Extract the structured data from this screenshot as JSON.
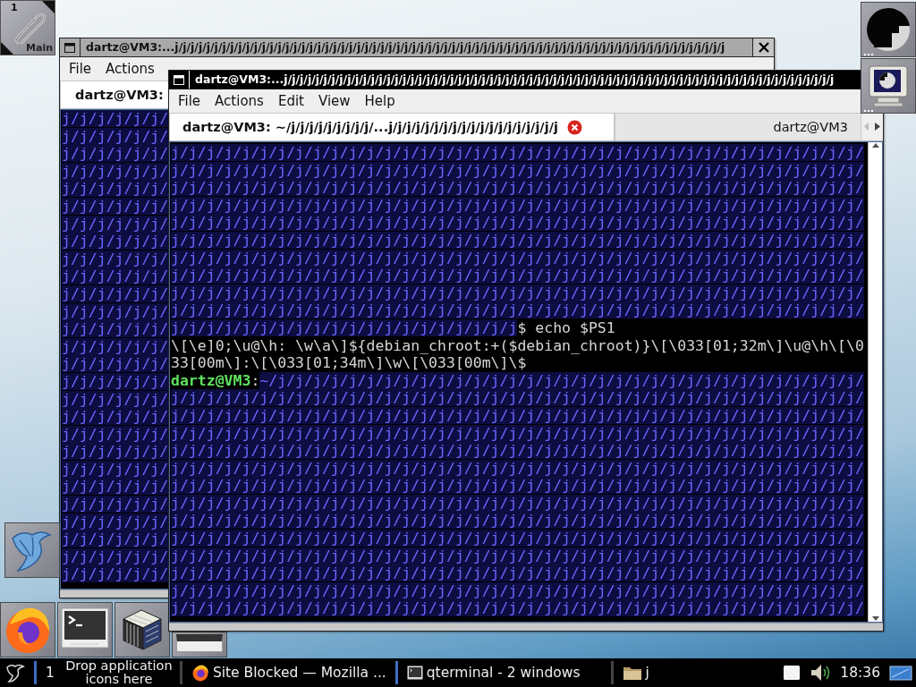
{
  "workspace_button": {
    "number": "1",
    "label": "Main"
  },
  "back_window": {
    "title": "dartz@VM3:...j/j/j/j/j/j/j/j/j/j/j/j/j/j/j/j/j/j/j/j/j/j/j/j/j/j/j/j/j/j/j/j/j/j/j/j/j/j/j/j/j/j/j/j/j/j/j/j/j/j/j/j/j/j/j/j/j/j/j/j/j/j/j/j/j/j/j/j/j/j",
    "menu": [
      "File",
      "Actions"
    ],
    "tabs": [
      {
        "label": "dartz@VM3:",
        "selected": true
      }
    ],
    "lines": [
      "j/j/j/j/j/j/",
      "j/j/j/j/j/j/",
      "j/j/j/j/j/j/",
      "j/j/j/j/j/j/",
      "j/j/j/j/j/j/",
      "j/j/j/j/j/j/",
      "j/j/j/j/j/j/",
      "j/j/j/j/j/j/",
      "j/j/j/j/j/j/",
      "j/j/j/j/j/j/",
      "j/j/j/j/j/j/",
      "j/j/j/j/j/j/",
      "j/j/j/j/j/j/",
      "j/j/j/j/j/j/",
      "j/j/j/j/j/j/",
      "j/j/j/j/j/j/",
      "j/j/j/j/j/j/",
      "j/j/j/j/j/j/",
      "j/j/j/j/j/j/",
      "j/j/j/j/j/j/",
      "j/j/j/j/j/j/",
      "j/j/j/j/j/j/",
      "j/j/j/j/j/j/",
      "j/j/j/j/j/j/",
      "j/j/j/j/j/j/",
      "j/j/j/j/j/j/",
      "j/j/j/j/j/j/"
    ]
  },
  "front_window": {
    "title": "dartz@VM3:...j/j/j/j/j/j/j/j/j/j/j/j/j/j/j/j/j/j/j/j/j/j/j/j/j/j/j/j/j/j/j/j/j/j/j/j/j/j/j/j/j/j/j/j/j/j/j/j/j/j/j/j/j/j/j/j/j/j/j/j/j/j/j/j/j/j/j/j/j/j",
    "menu": [
      "File",
      "Actions",
      "Edit",
      "View",
      "Help"
    ],
    "tabs": [
      {
        "label": "dartz@VM3: ~/j/j/j/j/j/j/j/j/j/...j/j/j/j/j/j/j/j/j/j/j/j/j/j/j/j/j/j/j",
        "selected": true
      },
      {
        "label": "dartz@VM3",
        "selected": false
      }
    ],
    "lines": [
      {
        "segments": [
          {
            "kind": "path",
            "text": "j/j/j/j/j/j/j/j/j/j/j/j/j/j/j/j/j/j/j/j/j/j/j/j/j/j/j/j/j/j/j/j/j/j/j/j/j/j/j/"
          }
        ]
      },
      {
        "segments": [
          {
            "kind": "path",
            "text": "j/j/j/j/j/j/j/j/j/j/j/j/j/j/j/j/j/j/j/j/j/j/j/j/j/j/j/j/j/j/j/j/j/j/j/j/j/j/j/"
          }
        ]
      },
      {
        "segments": [
          {
            "kind": "path",
            "text": "j/j/j/j/j/j/j/j/j/j/j/j/j/j/j/j/j/j/j/j/j/j/j/j/j/j/j/j/j/j/j/j/j/j/j/j/j/j/j/"
          }
        ]
      },
      {
        "segments": [
          {
            "kind": "path",
            "text": "j/j/j/j/j/j/j/j/j/j/j/j/j/j/j/j/j/j/j/j/j/j/j/j/j/j/j/j/j/j/j/j/j/j/j/j/j/j/j/"
          }
        ]
      },
      {
        "segments": [
          {
            "kind": "path",
            "text": "j/j/j/j/j/j/j/j/j/j/j/j/j/j/j/j/j/j/j/j/j/j/j/j/j/j/j/j/j/j/j/j/j/j/j/j/j/j/j/"
          }
        ]
      },
      {
        "segments": [
          {
            "kind": "path",
            "text": "j/j/j/j/j/j/j/j/j/j/j/j/j/j/j/j/j/j/j/j/j/j/j/j/j/j/j/j/j/j/j/j/j/j/j/j/j/j/j/"
          }
        ]
      },
      {
        "segments": [
          {
            "kind": "path",
            "text": "j/j/j/j/j/j/j/j/j/j/j/j/j/j/j/j/j/j/j/j/j/j/j/j/j/j/j/j/j/j/j/j/j/j/j/j/j/j/j/"
          }
        ]
      },
      {
        "segments": [
          {
            "kind": "path",
            "text": "j/j/j/j/j/j/j/j/j/j/j/j/j/j/j/j/j/j/j/j/j/j/j/j/j/j/j/j/j/j/j/j/j/j/j/j/j/j/j/"
          }
        ]
      },
      {
        "segments": [
          {
            "kind": "path",
            "text": "j/j/j/j/j/j/j/j/j/j/j/j/j/j/j/j/j/j/j/j/j/j/j/j/j/j/j/j/j/j/j/j/j/j/j/j/j/j/j/"
          }
        ]
      },
      {
        "segments": [
          {
            "kind": "path",
            "text": "j/j/j/j/j/j/j/j/j/j/j/j/j/j/j/j/j/j/j/j/j/j/j/j/j/j/j/j/j/j/j/j/j/j/j/j/j/j/j/"
          }
        ]
      },
      {
        "segments": [
          {
            "kind": "path",
            "text": "j/j/j/j/j/j/j/j/j/j/j/j/j/j/j/j/j/j/j/j"
          },
          {
            "kind": "plain",
            "text": "$ echo $PS1"
          }
        ]
      },
      {
        "segments": [
          {
            "kind": "plain",
            "text": "\\[\\e]0;\\u@\\h: \\w\\a\\]${debian_chroot:+($debian_chroot)}\\[\\033[01;32m\\]\\u@\\h\\[\\0"
          }
        ]
      },
      {
        "segments": [
          {
            "kind": "plain",
            "text": "33[00m\\]:\\[\\033[01;34m\\]\\w\\[\\033[00m\\]\\$"
          }
        ]
      },
      {
        "segments": [
          {
            "kind": "user",
            "text": "dartz@VM3"
          },
          {
            "kind": "plain",
            "text": ":"
          },
          {
            "kind": "path",
            "text": "~/j/j/j/j/j/j/j/j/j/j/j/j/j/j/j/j/j/j/j/j/j/j/j/j/j/j/j/j/j/j/j/j/j/"
          }
        ]
      },
      {
        "segments": [
          {
            "kind": "path",
            "text": "j/j/j/j/j/j/j/j/j/j/j/j/j/j/j/j/j/j/j/j/j/j/j/j/j/j/j/j/j/j/j/j/j/j/j/j/j/j/j/"
          }
        ]
      },
      {
        "segments": [
          {
            "kind": "path",
            "text": "j/j/j/j/j/j/j/j/j/j/j/j/j/j/j/j/j/j/j/j/j/j/j/j/j/j/j/j/j/j/j/j/j/j/j/j/j/j/j/"
          }
        ]
      },
      {
        "segments": [
          {
            "kind": "path",
            "text": "j/j/j/j/j/j/j/j/j/j/j/j/j/j/j/j/j/j/j/j/j/j/j/j/j/j/j/j/j/j/j/j/j/j/j/j/j/j/j/"
          }
        ]
      },
      {
        "segments": [
          {
            "kind": "path",
            "text": "j/j/j/j/j/j/j/j/j/j/j/j/j/j/j/j/j/j/j/j/j/j/j/j/j/j/j/j/j/j/j/j/j/j/j/j/j/j/j/"
          }
        ]
      },
      {
        "segments": [
          {
            "kind": "path",
            "text": "j/j/j/j/j/j/j/j/j/j/j/j/j/j/j/j/j/j/j/j/j/j/j/j/j/j/j/j/j/j/j/j/j/j/j/j/j/j/j/"
          }
        ]
      },
      {
        "segments": [
          {
            "kind": "path",
            "text": "j/j/j/j/j/j/j/j/j/j/j/j/j/j/j/j/j/j/j/j/j/j/j/j/j/j/j/j/j/j/j/j/j/j/j/j/j/j/j/"
          }
        ]
      },
      {
        "segments": [
          {
            "kind": "path",
            "text": "j/j/j/j/j/j/j/j/j/j/j/j/j/j/j/j/j/j/j/j/j/j/j/j/j/j/j/j/j/j/j/j/j/j/j/j/j/j/j/"
          }
        ]
      },
      {
        "segments": [
          {
            "kind": "path",
            "text": "j/j/j/j/j/j/j/j/j/j/j/j/j/j/j/j/j/j/j/j/j/j/j/j/j/j/j/j/j/j/j/j/j/j/j/j/j/j/j/"
          }
        ]
      },
      {
        "segments": [
          {
            "kind": "path",
            "text": "j/j/j/j/j/j/j/j/j/j/j/j/j/j/j/j/j/j/j/j/j/j/j/j/j/j/j/j/j/j/j/j/j/j/j/j/j/j/j/"
          }
        ]
      },
      {
        "segments": [
          {
            "kind": "path",
            "text": "j/j/j/j/j/j/j/j/j/j/j/j/j/j/j/j/j/j/j/j/j/j/j/j/j/j/j/j/j/j/j/j/j/j/j/j/j/j/j/"
          }
        ]
      },
      {
        "segments": [
          {
            "kind": "path",
            "text": "j/j/j/j/j/j/j/j/j/j/j/j/j/j/j/j/j/j/j/j/j/j/j/j/j/j/j/j/j/j/j/j/j/j/j/j/j/j/j/"
          }
        ]
      },
      {
        "segments": [
          {
            "kind": "path",
            "text": "j/j/j/j/j/j/j/j/j/j/j/j/j/j/j/j/j/j/j/j/j/j/j/j/j/j/j/j/j/j/j/j/j/j/j/j/j/j/j/"
          }
        ]
      },
      {
        "segments": [
          {
            "kind": "path",
            "text": "j/j/j/j/j/j/j/j/j/j/j/j/j/j/j/j/j/j/j/j/j/j/j/j/j/j/j/j/j/j/j/j/j/j/j/j/j/j/j/"
          }
        ]
      }
    ]
  },
  "taskbar": {
    "desktop_number": "1",
    "launcher_hint": "Drop application icons here",
    "tasks": [
      {
        "kind": "firefox",
        "label": "Site Blocked — Mozilla ..."
      },
      {
        "kind": "terminal",
        "label": "qterminal - 2 windows"
      },
      {
        "kind": "folder",
        "label": "j"
      }
    ],
    "clock": "18:36"
  }
}
